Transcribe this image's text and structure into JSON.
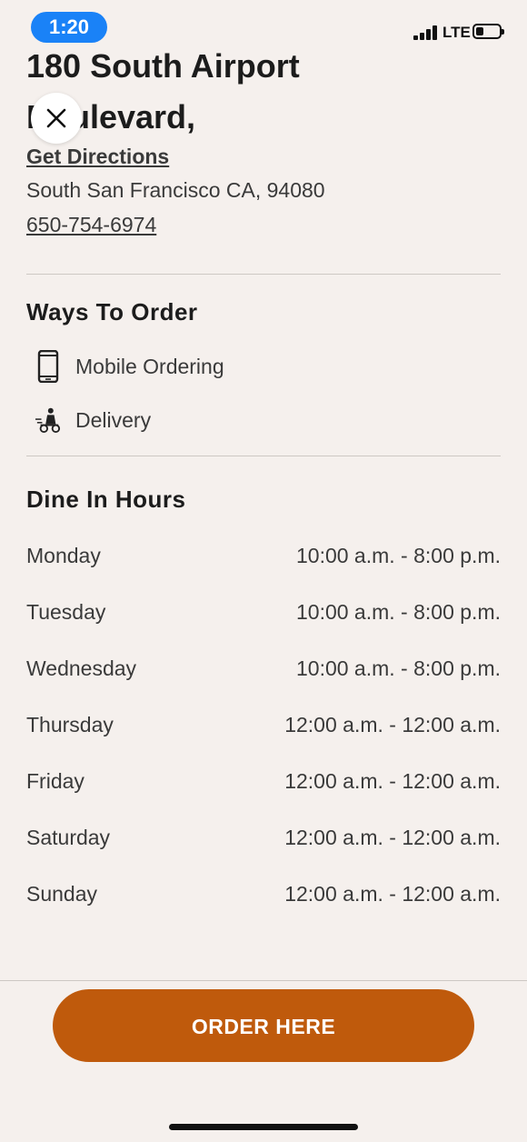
{
  "status_bar": {
    "time": "1:20",
    "network": "LTE"
  },
  "location": {
    "address_line1": "180 South Airport",
    "address_line2": "Boulevard,",
    "directions_label": "Get Directions",
    "city_line": "South San Francisco CA, 94080",
    "phone": "650-754-6974"
  },
  "ways_to_order": {
    "title": "Ways To Order",
    "items": [
      {
        "label": "Mobile Ordering",
        "icon": "mobile-phone-icon"
      },
      {
        "label": "Delivery",
        "icon": "delivery-scooter-icon"
      }
    ]
  },
  "dine_in_hours": {
    "title": "Dine In Hours",
    "rows": [
      {
        "day": "Monday",
        "hours": "10:00 a.m. - 8:00 p.m."
      },
      {
        "day": "Tuesday",
        "hours": "10:00 a.m. - 8:00 p.m."
      },
      {
        "day": "Wednesday",
        "hours": "10:00 a.m. - 8:00 p.m."
      },
      {
        "day": "Thursday",
        "hours": "12:00 a.m. - 12:00 a.m."
      },
      {
        "day": "Friday",
        "hours": "12:00 a.m. - 12:00 a.m."
      },
      {
        "day": "Saturday",
        "hours": "12:00 a.m. - 12:00 a.m."
      },
      {
        "day": "Sunday",
        "hours": "12:00 a.m. - 12:00 a.m."
      }
    ]
  },
  "order_button": {
    "label": "ORDER HERE",
    "color": "#bf5a0c"
  }
}
